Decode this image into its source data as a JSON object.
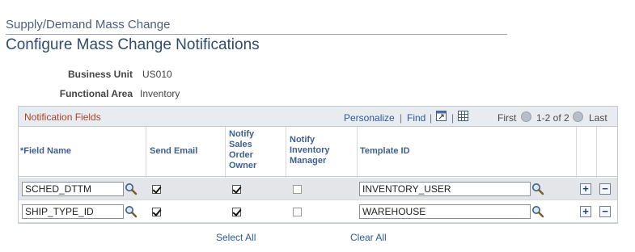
{
  "header": {
    "subtitle": "Supply/Demand Mass Change",
    "title": "Configure Mass Change Notifications"
  },
  "info": {
    "business_unit_label": "Business Unit",
    "business_unit_value": "US010",
    "functional_area_label": "Functional Area",
    "functional_area_value": "Inventory"
  },
  "grid": {
    "title": "Notification Fields",
    "personalize_label": "Personalize",
    "separator": "|",
    "find_label": "Find",
    "first_label": "First",
    "range_label": "1-2 of 2",
    "last_label": "Last",
    "icons": {
      "view_all": "zoom-window-icon",
      "download": "spreadsheet-icon",
      "prev": "previous-arrow-icon",
      "next": "next-arrow-icon",
      "lookup": "magnifier-icon"
    },
    "columns": {
      "field_name": "*Field Name",
      "send_email": "Send Email",
      "notify_sales_line1": "Notify",
      "notify_sales_line2": "Sales",
      "notify_sales_line3": "Order",
      "notify_sales_line4": "Owner",
      "notify_inv_line1": "Notify",
      "notify_inv_line2": "Inventory",
      "notify_inv_line3": "Manager",
      "template_id": "Template ID"
    },
    "rows": [
      {
        "field_name": "SCHED_DTTM",
        "send_email": true,
        "notify_sales_owner": true,
        "notify_inventory_manager": false,
        "template_id": "INVENTORY_USER"
      },
      {
        "field_name": "SHIP_TYPE_ID",
        "send_email": true,
        "notify_sales_owner": true,
        "notify_inventory_manager": false,
        "template_id": "WAREHOUSE"
      }
    ],
    "add_symbol": "+",
    "delete_symbol": "−"
  },
  "footer": {
    "select_all": "Select All",
    "clear_all": "Clear All"
  },
  "colors": {
    "link": "#2e5a9c",
    "grid_title": "#a8432a",
    "column_header": "#3f5f8f",
    "title": "#2f4b6e"
  }
}
